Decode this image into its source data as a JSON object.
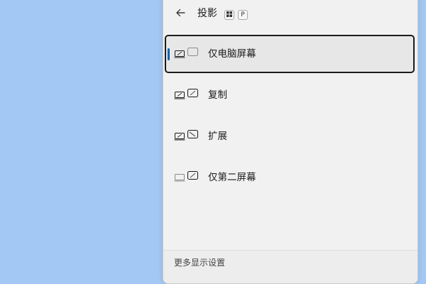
{
  "project_panel": {
    "back_icon": "back-arrow-icon",
    "title": "投影",
    "shortcut_keys": {
      "win_icon": "windows-logo-icon",
      "key": "P"
    },
    "options": [
      {
        "label": "仅电脑屏幕",
        "icon": "pc-screen-only-icon",
        "selected": true
      },
      {
        "label": "复制",
        "icon": "duplicate-icon",
        "selected": false
      },
      {
        "label": "扩展",
        "icon": "extend-icon",
        "selected": false
      },
      {
        "label": "仅第二屏幕",
        "icon": "second-screen-only-icon",
        "selected": false
      }
    ],
    "footer_link": "更多显示设置"
  },
  "colors": {
    "desktop": "#a4c8f4",
    "panel": "#f2f1f2",
    "accent": "#0063b1"
  }
}
